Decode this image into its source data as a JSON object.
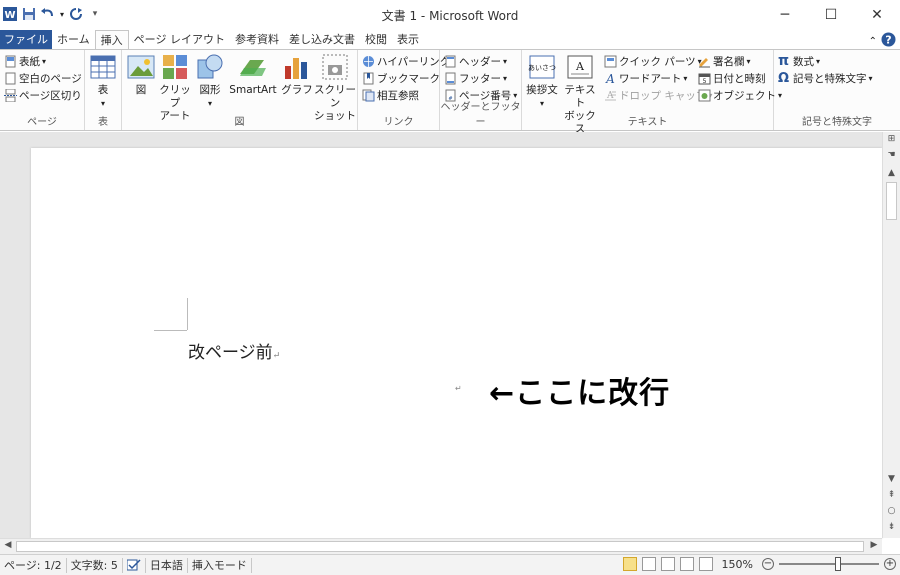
{
  "window": {
    "title": "文書 1 - Microsoft Word"
  },
  "window_controls": {
    "minimize": "─",
    "maximize": "☐",
    "close": "✕"
  },
  "quick_access": {
    "app_icon": "W",
    "customize": "▾"
  },
  "tabs": [
    {
      "label": "ファイル"
    },
    {
      "label": "ホーム"
    },
    {
      "label": "挿入"
    },
    {
      "label": "ページ レイアウト"
    },
    {
      "label": "参考資料"
    },
    {
      "label": "差し込み文書"
    },
    {
      "label": "校閲"
    },
    {
      "label": "表示"
    }
  ],
  "ribbon": {
    "pages": {
      "group_label": "ページ",
      "cover": "表紙",
      "blank": "空白のページ",
      "page_break": "ページ区切り"
    },
    "table": {
      "group_label": "表",
      "table": "表"
    },
    "illustrations": {
      "group_label": "図",
      "picture": "図",
      "clipart_1": "クリップ",
      "clipart_2": "アート",
      "shapes": "図形",
      "smartart": "SmartArt",
      "chart": "グラフ",
      "screenshot_1": "スクリーン",
      "screenshot_2": "ショット"
    },
    "links": {
      "group_label": "リンク",
      "hyperlink": "ハイパーリンク",
      "bookmark": "ブックマーク",
      "crossref": "相互参照"
    },
    "header_footer": {
      "group_label": "ヘッダーとフッター",
      "header": "ヘッダー",
      "footer": "フッター",
      "page_number": "ページ番号"
    },
    "text": {
      "group_label": "テキスト",
      "greeting": "挨拶文",
      "textbox_1": "テキスト",
      "textbox_2": "ボックス",
      "quick_parts": "クイック パーツ",
      "wordart": "ワードアート",
      "drop_cap": "ドロップ キャップ",
      "signature": "署名欄",
      "datetime": "日付と時刻",
      "object": "オブジェクト"
    },
    "symbols": {
      "group_label": "記号と特殊文字",
      "equation": "数式",
      "symbol": "記号と特殊文字"
    }
  },
  "document": {
    "line1": "改ページ前",
    "paragraph_mark": "↵",
    "annotation": "←ここに改行"
  },
  "statusbar": {
    "page": "ページ: 1/2",
    "wordcount": "文字数: 5",
    "language": "日本語",
    "mode": "挿入モード",
    "zoom": "150%",
    "zoom_level": 0.6
  },
  "colors": {
    "file_tab": "#2b579a",
    "accent": "#2b579a"
  }
}
